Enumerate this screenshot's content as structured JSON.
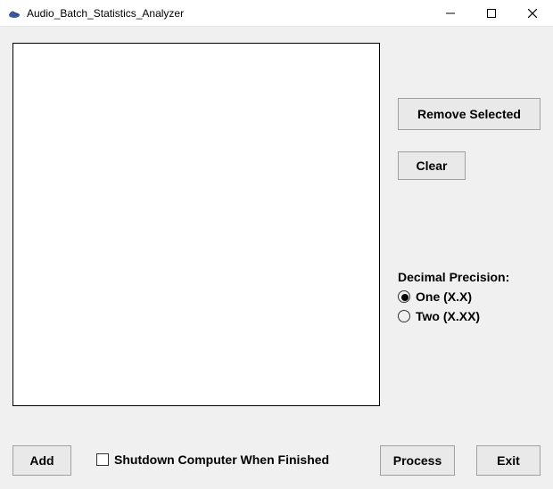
{
  "window": {
    "title": "Audio_Batch_Statistics_Analyzer"
  },
  "buttons": {
    "remove_selected": "Remove Selected",
    "clear": "Clear",
    "add": "Add",
    "process": "Process",
    "exit": "Exit"
  },
  "precision": {
    "label": "Decimal Precision:",
    "options": [
      {
        "label": "One (X.X)",
        "checked": true
      },
      {
        "label": "Two (X.XX)",
        "checked": false
      }
    ]
  },
  "shutdown": {
    "label": "Shutdown Computer When Finished",
    "checked": false
  },
  "list": {
    "items": []
  }
}
